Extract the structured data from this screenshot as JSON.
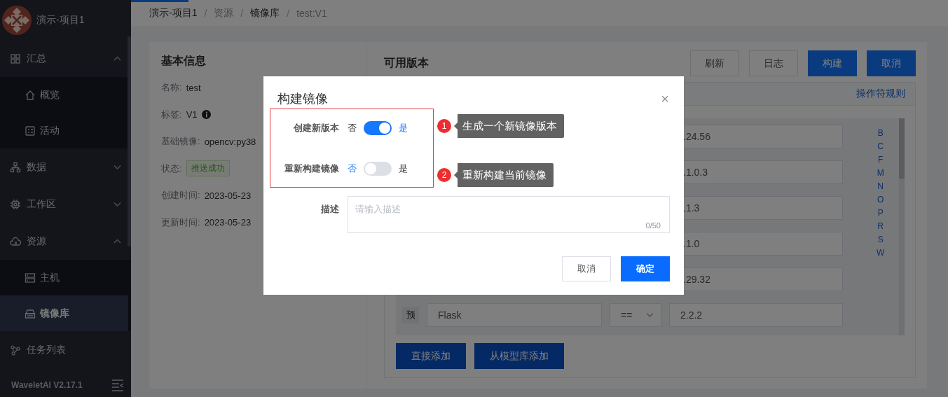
{
  "loading_bar": {
    "level": 0.07
  },
  "sidebar": {
    "project": "演示-项目1",
    "groups": [
      {
        "label": "汇总",
        "expanded": true,
        "children": [
          {
            "label": "概览",
            "selected": false
          },
          {
            "label": "活动",
            "selected": false
          }
        ]
      },
      {
        "label": "数据",
        "expanded": false
      },
      {
        "label": "工作区",
        "expanded": false
      },
      {
        "label": "资源",
        "expanded": true,
        "children": [
          {
            "label": "主机",
            "selected": false
          },
          {
            "label": "镜像库",
            "selected": true
          }
        ]
      },
      {
        "label": "任务列表"
      }
    ],
    "version": "WaveletAI V2.17.1"
  },
  "breadcrumb": [
    {
      "label": "演示-项目1",
      "link": true
    },
    {
      "separator": "/",
      "label": "资源",
      "link": false
    },
    {
      "separator": "/",
      "label": "镜像库",
      "link": true
    },
    {
      "separator": "/",
      "label": "test:V1",
      "link": false
    }
  ],
  "basic_info": {
    "title": "基本信息",
    "fields": [
      {
        "label": "名称:",
        "value": "test",
        "kind": "text"
      },
      {
        "label": "标签:",
        "value": "V1",
        "kind": "info"
      },
      {
        "label": "基础镜像:",
        "value": "opencv:py38",
        "kind": "text"
      },
      {
        "label": "状态:",
        "value": "推送成功",
        "kind": "tag"
      },
      {
        "label": "创建时间:",
        "value": "2023-05-23",
        "kind": "text"
      },
      {
        "label": "更新时间:",
        "value": "2023-05-23",
        "kind": "text"
      }
    ]
  },
  "versions": {
    "title": "可用版本",
    "buttons": [
      {
        "label": "刷新",
        "primary": false
      },
      {
        "label": "日志",
        "primary": false
      },
      {
        "label": "构建",
        "primary": true
      },
      {
        "label": "取消",
        "primary": true
      }
    ],
    "rules_link": "操作符规则",
    "rows": [
      {
        "kind": "partial",
        "value": ".24.56"
      },
      {
        "kind": "partial",
        "value": ".1.0.3"
      },
      {
        "kind": "partial",
        "value": ".1.3"
      },
      {
        "kind": "partial",
        "value": ".1.0"
      },
      {
        "kind": "partial",
        "value": ".29.32"
      },
      {
        "kind": "full",
        "prefix": "预",
        "name": "Flask",
        "operator": "==",
        "value": "2.2.2"
      }
    ],
    "index_letters": [
      "B",
      "C",
      "F",
      "M",
      "N",
      "O",
      "P",
      "R",
      "S",
      "W"
    ],
    "add_buttons": [
      "直接添加",
      "从模型库添加"
    ]
  },
  "dialog": {
    "title": "构建镜像",
    "close": "×",
    "switches": [
      {
        "label": "创建新版本",
        "off_text": "否",
        "on_text": "是",
        "on": true
      },
      {
        "label": "重新构建镜像",
        "off_text": "否",
        "on_text": "是",
        "on": false
      }
    ],
    "description": {
      "label": "描述",
      "placeholder": "请输入描述",
      "counter": "0/50"
    },
    "buttons": [
      {
        "label": "取消",
        "primary": false
      },
      {
        "label": "确定",
        "primary": true
      }
    ]
  },
  "annotations": [
    {
      "number": "1",
      "text": "生成一个新镜像版本"
    },
    {
      "number": "2",
      "text": "重新构建当前镜像"
    }
  ]
}
